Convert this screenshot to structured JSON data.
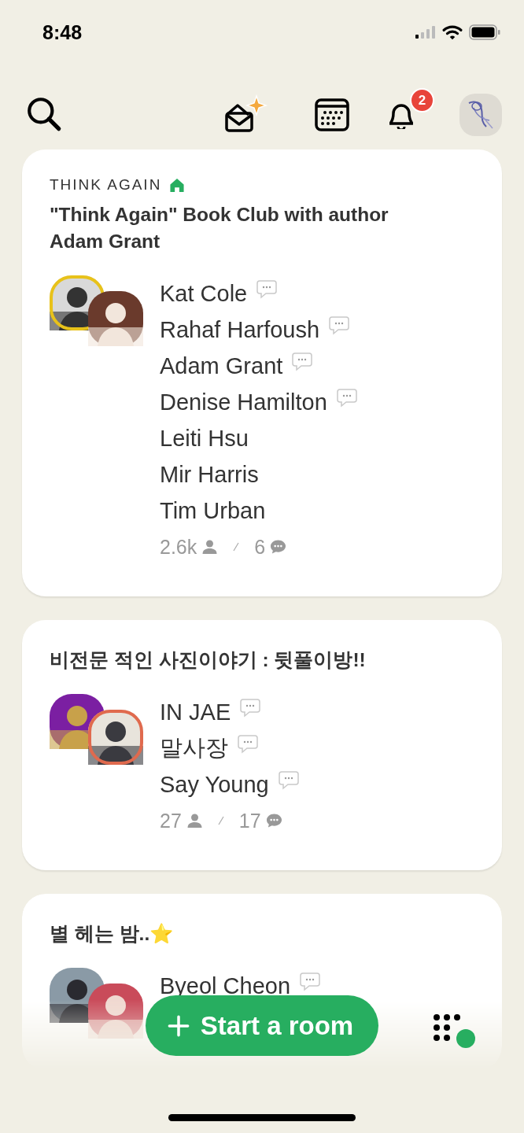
{
  "status_bar": {
    "time": "8:48"
  },
  "header": {
    "notification_count": "2"
  },
  "rooms": [
    {
      "club": "THINK AGAIN",
      "club_home": true,
      "title": "\"Think Again\" Book Club with author Adam Grant",
      "avatars": [
        {
          "ring": true,
          "color": "#e8c21a"
        },
        {
          "ring": false
        }
      ],
      "speakers": [
        {
          "name": "Kat Cole",
          "chat_bubble": true
        },
        {
          "name": "Rahaf Harfoush",
          "chat_bubble": true
        },
        {
          "name": "Adam Grant",
          "chat_bubble": true
        },
        {
          "name": "Denise Hamilton",
          "chat_bubble": true
        },
        {
          "name": "Leiti Hsu",
          "chat_bubble": false
        },
        {
          "name": "Mir Harris",
          "chat_bubble": false
        },
        {
          "name": "Tim Urban",
          "chat_bubble": false
        }
      ],
      "listeners": "2.6k",
      "speaker_count": "6"
    },
    {
      "title": "비전문 적인 사진이야기 : 뒷풀이방!!",
      "avatars": [
        {
          "ring": false
        },
        {
          "ring": true,
          "color": "#e06a4e"
        }
      ],
      "speakers": [
        {
          "name": "IN JAE",
          "chat_bubble": true
        },
        {
          "name": "말사장",
          "chat_bubble": true
        },
        {
          "name": "Say Young",
          "chat_bubble": true
        }
      ],
      "listeners": "27",
      "speaker_count": "17"
    },
    {
      "title": "별 헤는 밤..⭐",
      "avatars": [
        {
          "ring": false
        },
        {
          "ring": false
        }
      ],
      "speakers": [
        {
          "name": "Byeol Cheon",
          "chat_bubble": true
        }
      ]
    }
  ],
  "start_button": "Start a room"
}
